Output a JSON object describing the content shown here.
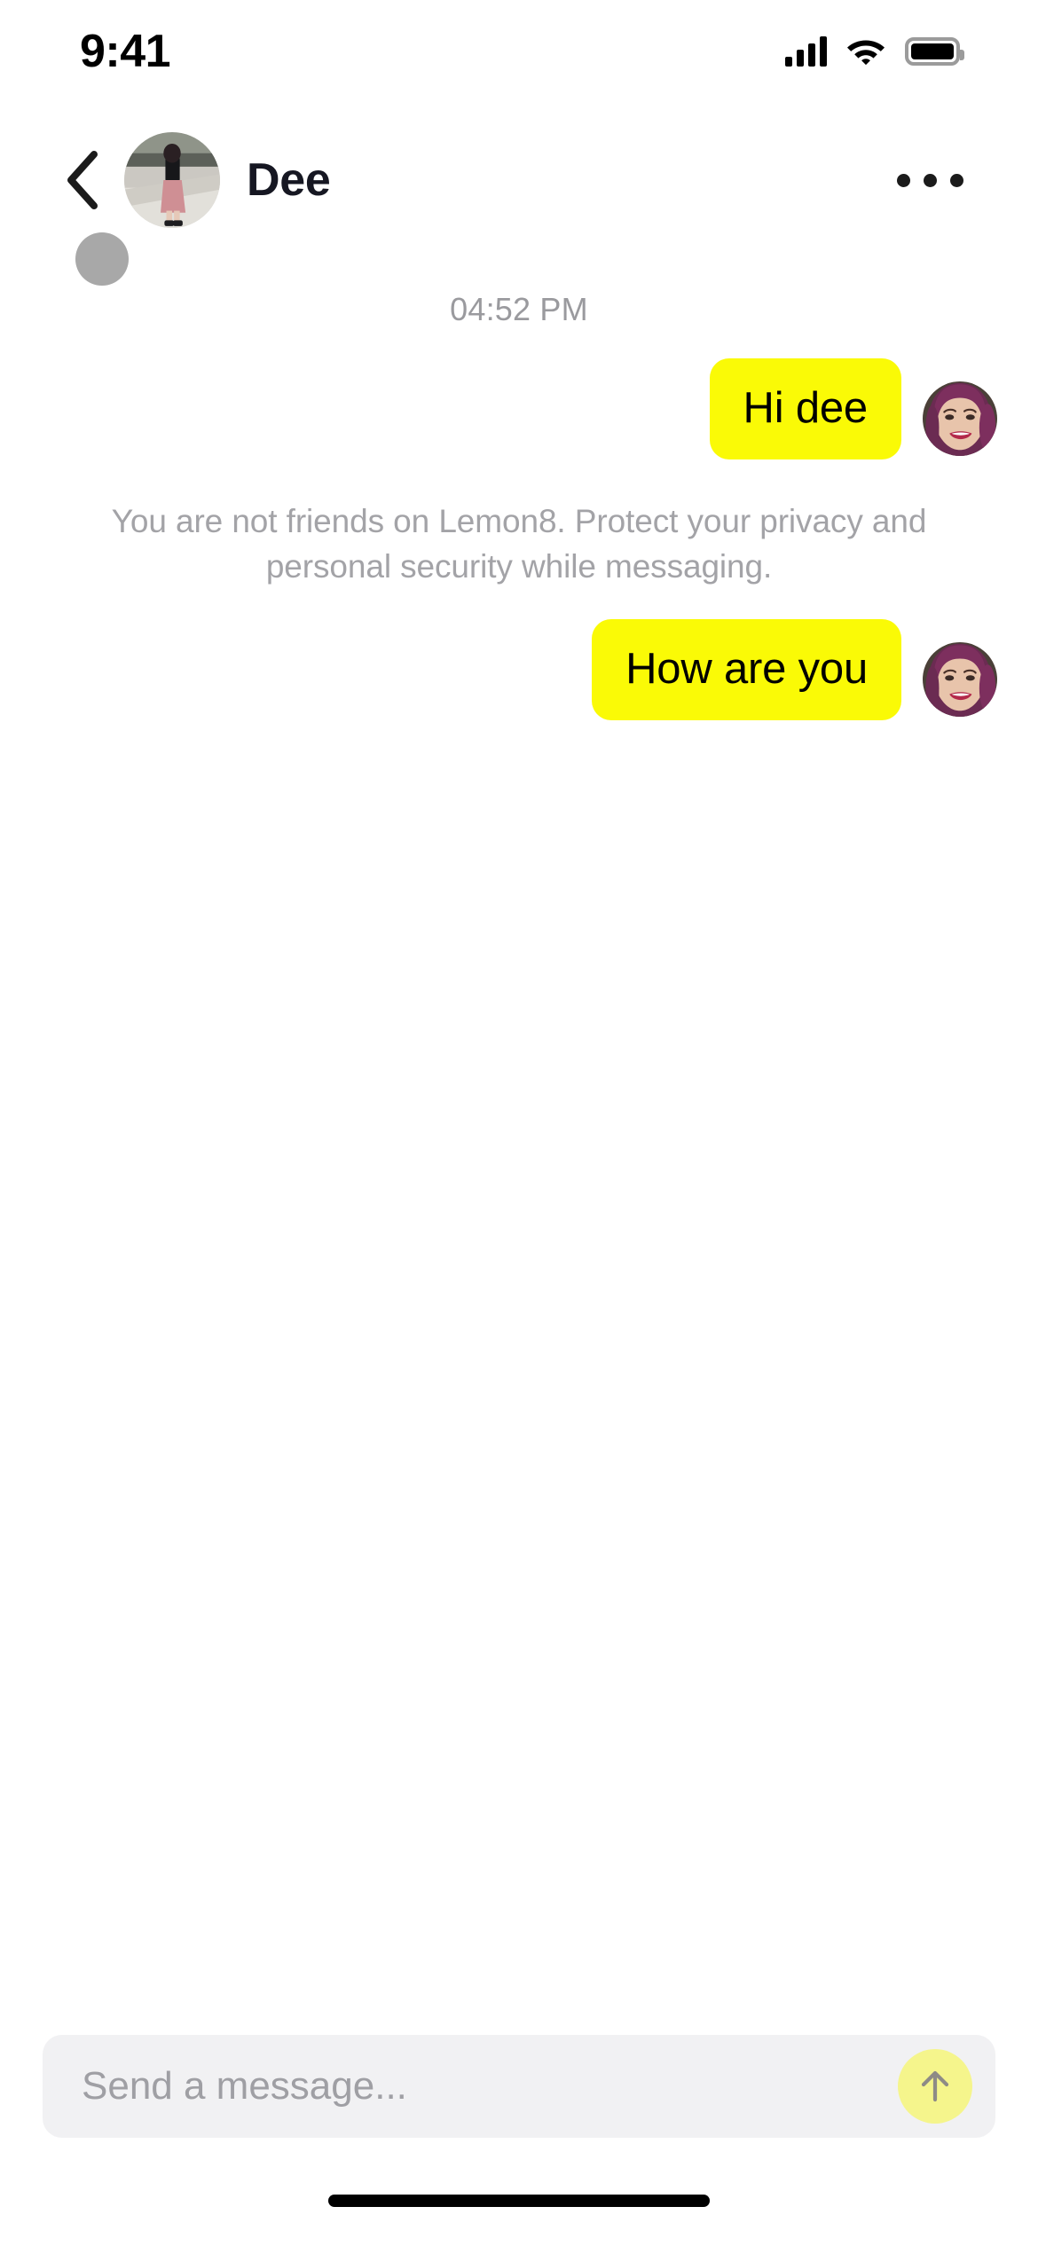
{
  "status_bar": {
    "time": "9:41",
    "cellular_icon": "cellular-signal-icon",
    "wifi_icon": "wifi-icon",
    "battery_icon": "battery-full-icon"
  },
  "nav": {
    "back_icon": "chevron-left-icon",
    "avatar_icon": "contact-avatar-photo",
    "title": "Dee",
    "more_icon": "more-options-icon"
  },
  "chat": {
    "presence_indicator": "presence-dot",
    "timestamp": "04:52 PM",
    "bubble_color": "#FAFA06",
    "messages": [
      {
        "text": "Hi dee",
        "side": "outgoing",
        "avatar": "sender-avatar-photo"
      },
      {
        "text": "How are you",
        "side": "outgoing",
        "avatar": "sender-avatar-photo"
      }
    ],
    "system_notice": "You are not friends on Lemon8. Protect your privacy and personal security while messaging."
  },
  "composer": {
    "placeholder": "Send a message...",
    "value": "",
    "send_icon": "arrow-up-icon",
    "send_button_color": "#F5F58C",
    "field_color": "#F1F1F3"
  },
  "home_indicator": "home-indicator-bar"
}
